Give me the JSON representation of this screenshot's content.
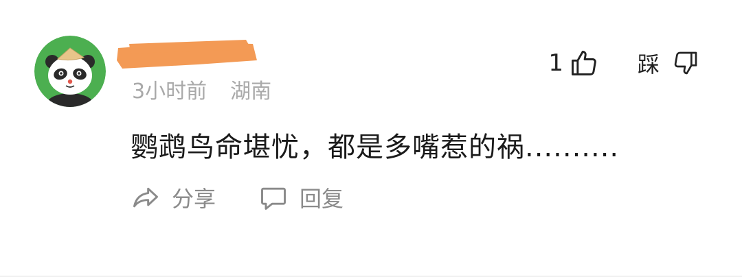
{
  "comment": {
    "avatar_icon": "panda-avatar-icon",
    "username_redacted": true,
    "time": "3小时前",
    "location": "湖南",
    "text": "鹦鹉鸟命堪忧，都是多嘴惹的祸..........",
    "like_count": "1",
    "dislike_label": "踩",
    "share_label": "分享",
    "reply_label": "回复"
  },
  "colors": {
    "redaction": "#f39a55",
    "avatar_bg": "#4caf50",
    "meta_text": "#a9a9a9",
    "action_text": "#8a8a8a"
  }
}
